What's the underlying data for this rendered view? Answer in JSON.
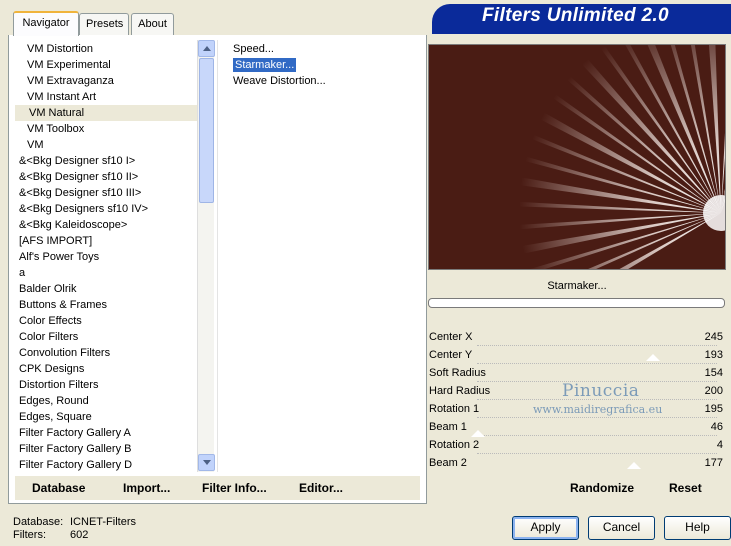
{
  "tabs": [
    {
      "label": "Navigator"
    },
    {
      "label": "Presets"
    },
    {
      "label": "About"
    }
  ],
  "banner": {
    "title": "Filters Unlimited 2.0"
  },
  "categories": [
    {
      "label": "VM Distortion"
    },
    {
      "label": "VM Experimental"
    },
    {
      "label": "VM Extravaganza"
    },
    {
      "label": "VM Instant Art"
    },
    {
      "label": "VM Natural"
    },
    {
      "label": "VM Toolbox"
    },
    {
      "label": "VM"
    },
    {
      "label": "&<Bkg Designer sf10 I>"
    },
    {
      "label": "&<Bkg Designer sf10 II>"
    },
    {
      "label": "&<Bkg Designer sf10 III>"
    },
    {
      "label": "&<Bkg Designers sf10 IV>"
    },
    {
      "label": "&<Bkg Kaleidoscope>"
    },
    {
      "label": "[AFS IMPORT]"
    },
    {
      "label": "Alf's Power Toys"
    },
    {
      "label": "a"
    },
    {
      "label": "Balder Olrik"
    },
    {
      "label": "Buttons & Frames"
    },
    {
      "label": "Color Effects"
    },
    {
      "label": "Color Filters"
    },
    {
      "label": "Convolution Filters"
    },
    {
      "label": "CPK Designs"
    },
    {
      "label": "Distortion Filters"
    },
    {
      "label": "Edges, Round"
    },
    {
      "label": "Edges, Square"
    },
    {
      "label": "Filter Factory Gallery A"
    },
    {
      "label": "Filter Factory Gallery B"
    },
    {
      "label": "Filter Factory Gallery D"
    }
  ],
  "filters": [
    {
      "label": "Speed..."
    },
    {
      "label": "Starmaker..."
    },
    {
      "label": "Weave Distortion..."
    }
  ],
  "left_buttons": {
    "database": "Database",
    "import": "Import...",
    "filter_info": "Filter Info...",
    "editor": "Editor..."
  },
  "preview": {
    "filter_name": "Starmaker..."
  },
  "params": [
    {
      "name": "Center X",
      "value": "245"
    },
    {
      "name": "Center Y",
      "value": "193"
    },
    {
      "name": "Soft Radius",
      "value": "154"
    },
    {
      "name": "Hard Radius",
      "value": "200"
    },
    {
      "name": "Rotation 1",
      "value": "195"
    },
    {
      "name": "Beam 1",
      "value": "46"
    },
    {
      "name": "Rotation 2",
      "value": "4"
    },
    {
      "name": "Beam 2",
      "value": "177"
    }
  ],
  "watermark": {
    "name": "Pinuccia",
    "url": "www.maidiregrafica.eu"
  },
  "right_buttons": {
    "randomize": "Randomize",
    "reset": "Reset"
  },
  "footer": {
    "database_label": "Database:",
    "database_value": "ICNET-Filters",
    "filters_label": "Filters:",
    "filters_value": "602"
  },
  "dialog_buttons": {
    "apply": "Apply",
    "cancel": "Cancel",
    "help": "Help"
  },
  "colors": {
    "preview_bg": "#4a1c14",
    "banner": "#0a2a9a",
    "selection": "#316ac5"
  }
}
